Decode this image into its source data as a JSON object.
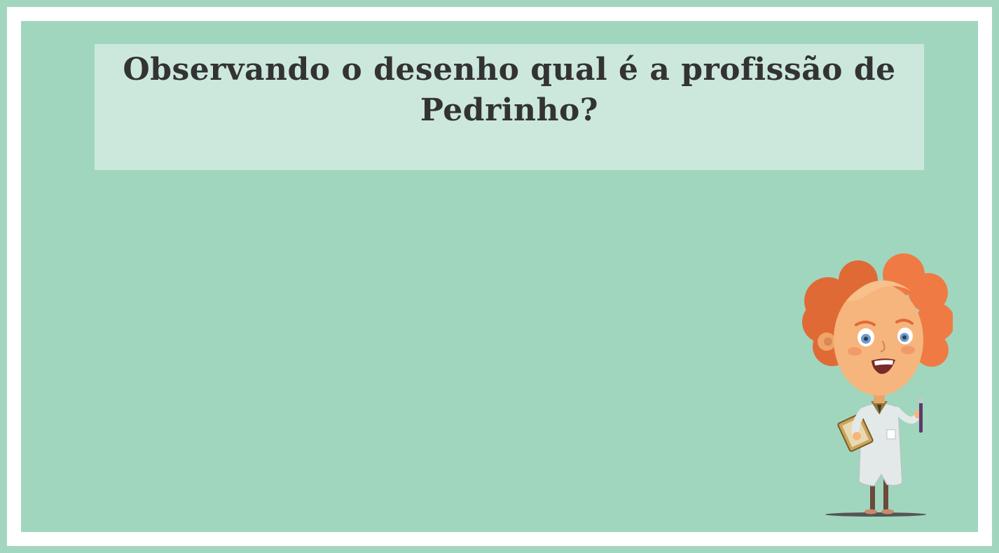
{
  "slide": {
    "question": "Observando o desenho qual é a profissão de Pedrinho?"
  },
  "illustration": {
    "icon": "scientist-character-icon",
    "colors": {
      "hair": "#ea7440",
      "skin": "#f6b57c",
      "coat": "#e3e9e8",
      "background": "#a0d6be",
      "border": "#ffffff",
      "text_box": "#cce8dc",
      "text": "#333333"
    }
  }
}
